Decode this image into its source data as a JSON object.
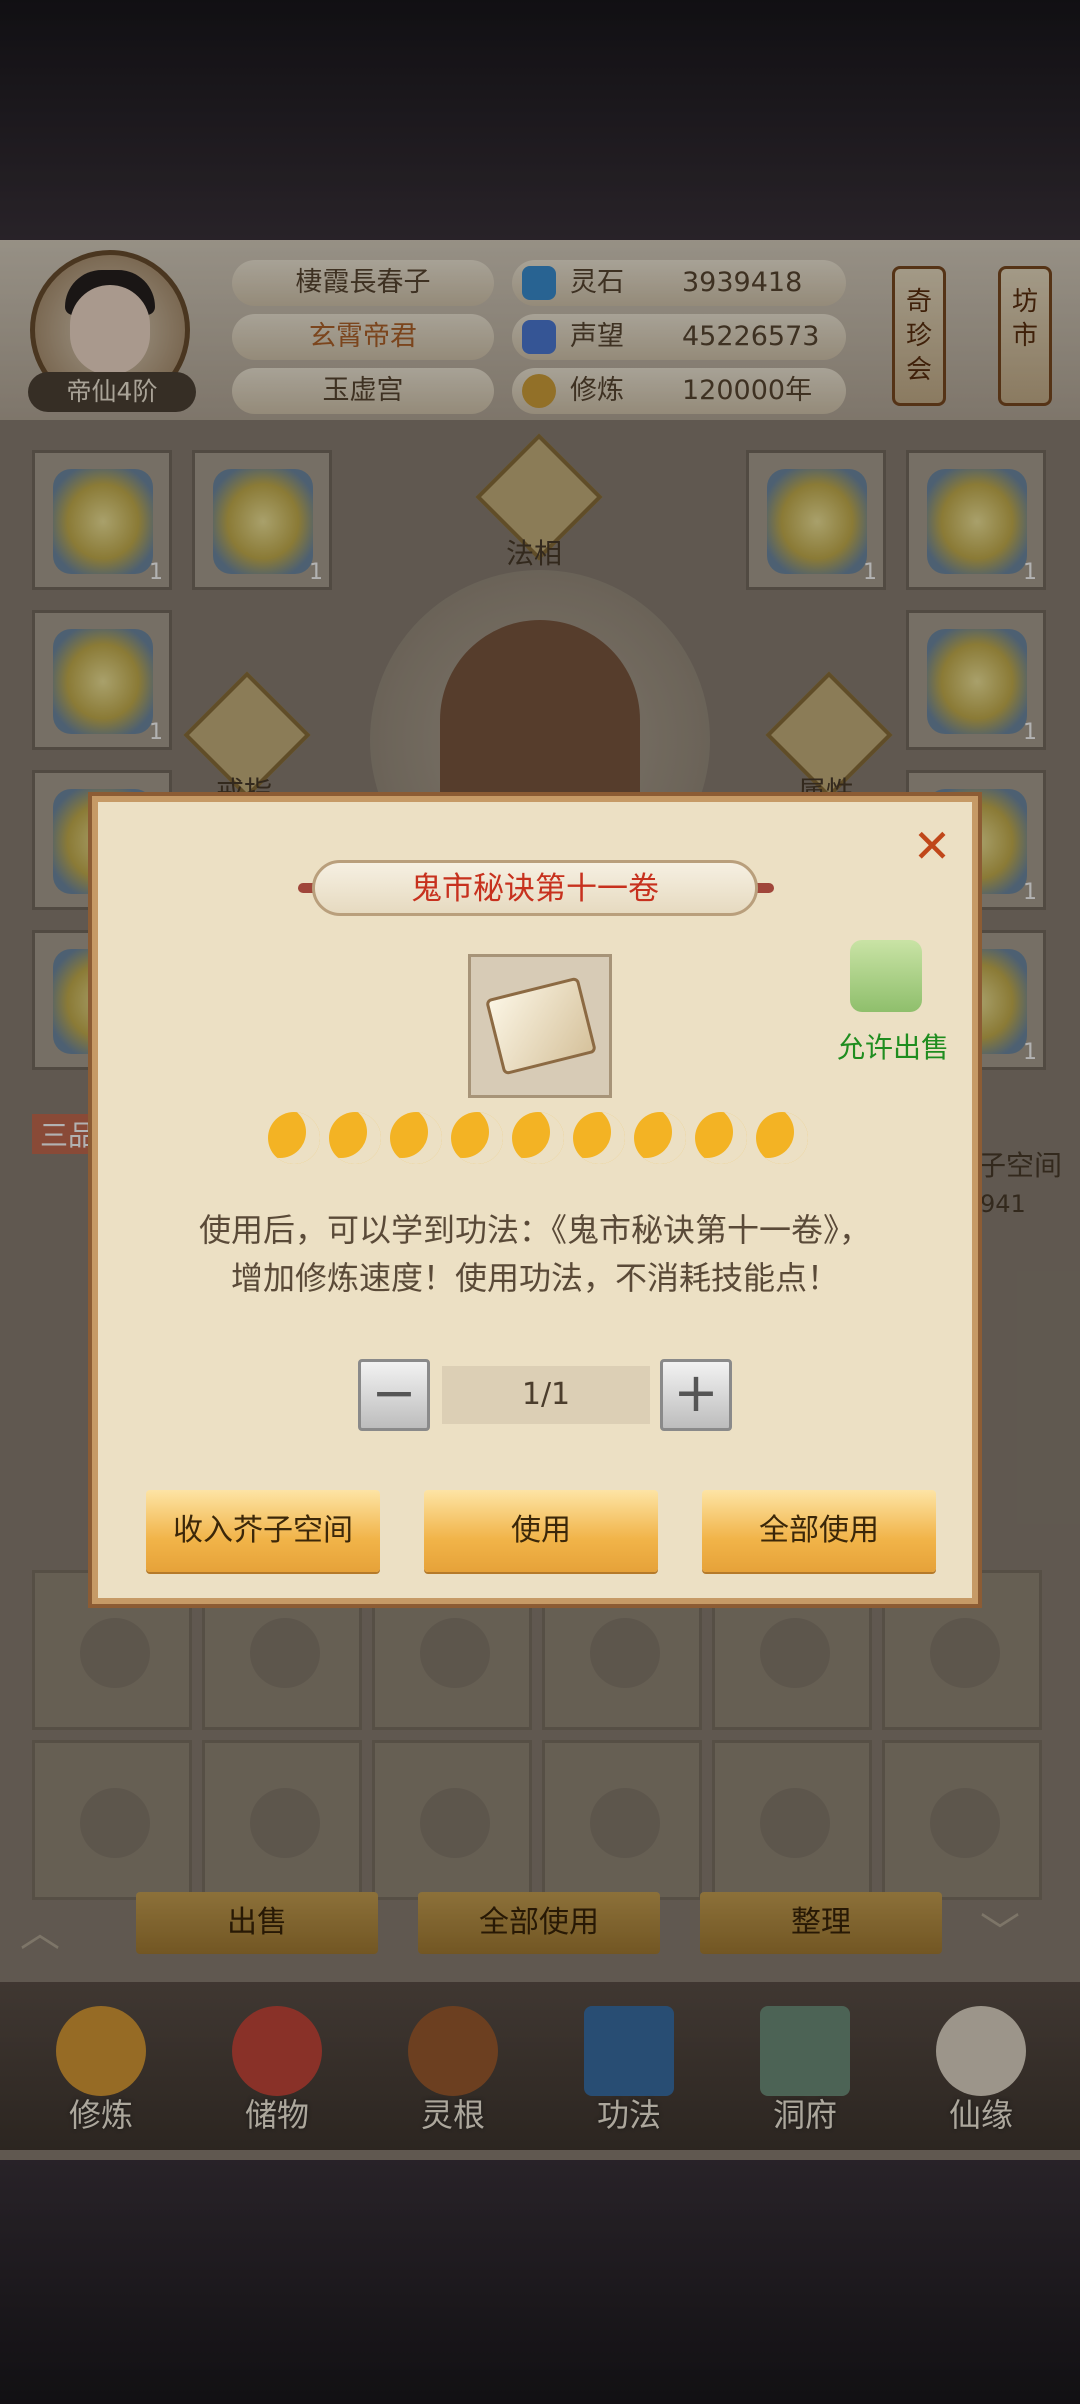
{
  "player": {
    "rank": "帝仙4阶",
    "name": "棲霞長春子",
    "title": "玄霄帝君",
    "sect": "玉虚宫"
  },
  "stats": [
    {
      "label": "灵石",
      "value": "3939418",
      "icon": "spirit-stone-icon",
      "color": "#3a8fd1"
    },
    {
      "label": "声望",
      "value": "45226573",
      "icon": "reputation-crystal-icon",
      "color": "#4c7ad6"
    },
    {
      "label": "修炼",
      "value": "120000年",
      "icon": "meditation-icon",
      "color": "#d1a13a"
    }
  ],
  "side_shops": [
    {
      "label": "奇珍会"
    },
    {
      "label": "坊市"
    }
  ],
  "equipment": {
    "faxiang_label": "法相",
    "ring_label": "戒指",
    "attribute_label": "属性",
    "slot_count": "1"
  },
  "background_text": {
    "grade_tab": "三品",
    "storage_label": "芥子空间",
    "storage_count": "941"
  },
  "bag_actions": {
    "sell": "出售",
    "use_all": "全部使用",
    "organize": "整理"
  },
  "tabs": [
    {
      "label": "修炼",
      "icon": "cultivation-icon"
    },
    {
      "label": "储物",
      "icon": "storage-bag-icon"
    },
    {
      "label": "灵根",
      "icon": "spirit-root-icon"
    },
    {
      "label": "功法",
      "icon": "technique-book-icon"
    },
    {
      "label": "洞府",
      "icon": "cave-dwelling-icon"
    },
    {
      "label": "仙缘",
      "icon": "immortal-fate-icon"
    }
  ],
  "modal": {
    "title": "鬼市秘诀第十一卷",
    "close_icon": "close-icon",
    "item_icon": "scripture-book-icon",
    "sellable_label": "允许出售",
    "quality_moons": 9,
    "description_line1": "使用后，可以学到功法：《鬼市秘诀第十一卷》，",
    "description_line2": "增加修炼速度！使用功法，不消耗技能点！",
    "decrement_label": "−",
    "increment_label": "+",
    "quantity": "1/1",
    "store_button": "收入芥子空间",
    "use_button": "使用",
    "use_all_button": "全部使用",
    "accent_color": "#c7311e",
    "sellable_color": "#1f8d1f"
  }
}
